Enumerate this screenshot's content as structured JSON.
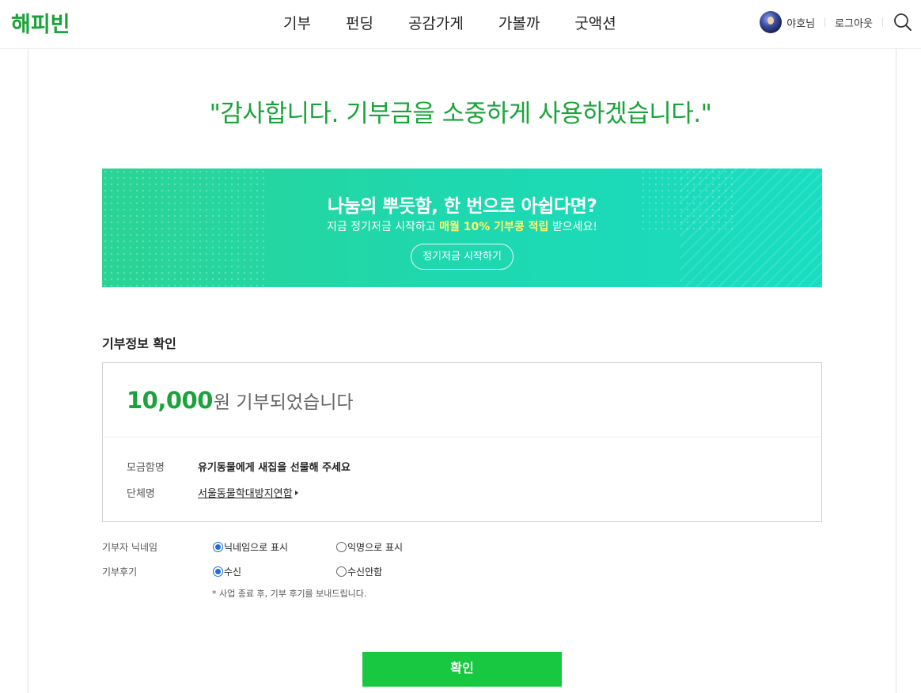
{
  "header": {
    "logo": "해피빈",
    "nav": [
      "기부",
      "펀딩",
      "공감가게",
      "가볼까",
      "굿액션"
    ],
    "user_nickname": "야호님",
    "logout_label": "로그아웃"
  },
  "thanks_message": "\"감사합니다. 기부금을 소중하게 사용하겠습니다.\"",
  "banner": {
    "title": "나눔의 뿌듯함, 한 번으로 아쉽다면?",
    "sub_prefix": "지금 정기저금 시작하고 ",
    "sub_highlight": "매월 10% 기부콩 적립",
    "sub_suffix": " 받으세요!",
    "button_label": "정기저금 시작하기"
  },
  "donation": {
    "section_title": "기부정보 확인",
    "amount": "10,000",
    "amount_unit": "원",
    "amount_text": " 기부되었습니다",
    "campaign_label": "모금함명",
    "campaign_value": "유기동물에게 새집을 선물해 주세요",
    "org_label": "단체명",
    "org_value": "서울동물학대방지연합"
  },
  "options": {
    "nickname_label": "기부자 닉네임",
    "nickname_opt1": "닉네임으로 표시",
    "nickname_opt2": "익명으로 표시",
    "review_label": "기부후기",
    "review_opt1": "수신",
    "review_opt2": "수신안함",
    "note": "* 사업 종료 후, 기부 후기를 보내드립니다."
  },
  "confirm_label": "확인",
  "colors": {
    "brand_green": "#1aa33a",
    "button_green": "#17c840",
    "banner_start": "#2bd495",
    "banner_end": "#19ddc2",
    "highlight_yellow": "#fff46b"
  }
}
